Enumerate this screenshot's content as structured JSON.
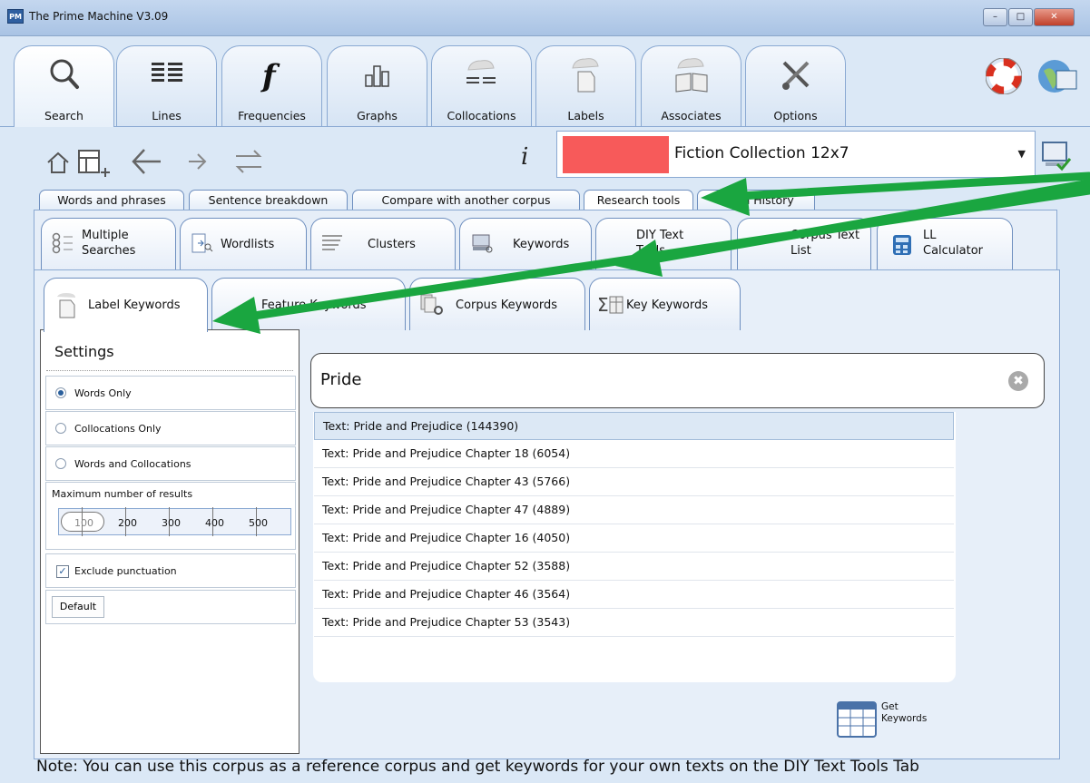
{
  "window": {
    "title": "The Prime Machine V3.09",
    "icon_text": "PM",
    "minimize": "–",
    "maximize": "□",
    "close": "✕"
  },
  "main_tabs": [
    {
      "label": "Search",
      "icon": "magnifier-icon"
    },
    {
      "label": "Lines",
      "icon": "lines-icon"
    },
    {
      "label": "Frequencies",
      "icon": "function-icon"
    },
    {
      "label": "Graphs",
      "icon": "bar-graph-icon"
    },
    {
      "label": "Collocations",
      "icon": "cloud-lines-icon"
    },
    {
      "label": "Labels",
      "icon": "cloud-doc-icon"
    },
    {
      "label": "Associates",
      "icon": "cloud-book-icon"
    },
    {
      "label": "Options",
      "icon": "tools-icon"
    }
  ],
  "corpus": {
    "name": "Fiction Collection 12x7",
    "swatch_color": "#f75a5a"
  },
  "research_tabs": [
    "Words and phrases",
    "Sentence breakdown",
    "Compare with another corpus",
    "Research tools",
    "earch History"
  ],
  "tool_tabs": [
    {
      "line1": "Multiple",
      "line2": "Searches"
    },
    {
      "line1": "Wordlists",
      "line2": ""
    },
    {
      "line1": "Clusters",
      "line2": ""
    },
    {
      "line1": "Keywords",
      "line2": ""
    },
    {
      "line1": "DIY Text",
      "line2": "Tools"
    },
    {
      "line1": "Corpus Text",
      "line2": "List"
    },
    {
      "line1": "LL",
      "line2": "Calculator"
    }
  ],
  "keyword_tabs": [
    "Label Keywords",
    "Feature Keywords",
    "Corpus Keywords",
    "Key Keywords"
  ],
  "settings": {
    "title": "Settings",
    "options": [
      "Words Only",
      "Collocations Only",
      "Words and Collocations"
    ],
    "selected_option": "Words Only",
    "max_results_label": "Maximum number of results",
    "max_values": [
      "100",
      "200",
      "300",
      "400",
      "500"
    ],
    "max_selected": "100",
    "exclude_punctuation": "Exclude punctuation",
    "exclude_checked": true,
    "default_button": "Default"
  },
  "search": {
    "query": "Pride",
    "clear": "✖"
  },
  "results": [
    "Text: Pride and Prejudice (144390)",
    "Text: Pride and Prejudice Chapter 18 (6054)",
    "Text: Pride and Prejudice Chapter 43 (5766)",
    "Text: Pride and Prejudice Chapter 47 (4889)",
    "Text: Pride and Prejudice Chapter 16 (4050)",
    "Text: Pride and Prejudice Chapter 52 (3588)",
    "Text: Pride and Prejudice Chapter 46 (3564)",
    "Text: Pride and Prejudice Chapter 53 (3543)"
  ],
  "get_keywords": {
    "line1": "Get",
    "line2": "Keywords"
  },
  "info_glyph": "i",
  "note": "Note: You can use this corpus as a reference corpus and get keywords for your own texts on the DIY Text Tools Tab",
  "annotation_color": "#1aa640"
}
